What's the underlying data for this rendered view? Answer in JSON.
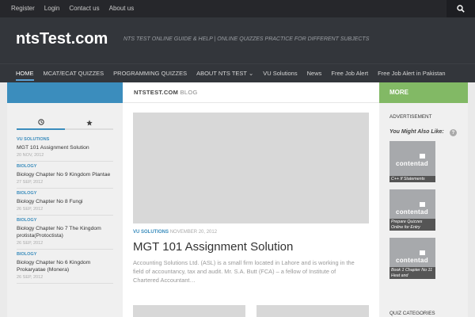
{
  "topbar": {
    "links": [
      "Register",
      "Login",
      "Contact us",
      "About us"
    ]
  },
  "header": {
    "site_title": "ntsTest.com",
    "tagline": "NTS TEST ONLINE GUIDE & HELP | ONLINE QUIZZES PRACTICE FOR DIFFERENT SUBJECTS"
  },
  "mainnav": {
    "items": [
      "HOME",
      "MCAT/ECAT QUIZZES",
      "PROGRAMMING QUIZZES",
      "ABOUT NTS TEST",
      "VU Solutions",
      "News",
      "Free Job Alert",
      "Free Job Alert in Pakistan"
    ],
    "dropdown_caret": "⌄"
  },
  "blog_head": {
    "site": "NTSTEST.COM",
    "label": "BLOG"
  },
  "more_label": "MORE",
  "sidebar_posts": [
    {
      "cat": "VU SOLUTIONS",
      "title": "MGT 101 Assignment Solution",
      "date": "20 NOV, 2012"
    },
    {
      "cat": "BIOLOGY",
      "title": "Biology Chapter No 9 Kingdom Plantae",
      "date": "27 SEP, 2012"
    },
    {
      "cat": "BIOLOGY",
      "title": "Biology Chapter No 8 Fungi",
      "date": "26 SEP, 2012"
    },
    {
      "cat": "BIOLOGY",
      "title": "Biology Chapter No 7 The Kingdom protista(Protoctista)",
      "date": "26 SEP, 2012"
    },
    {
      "cat": "BIOLOGY",
      "title": "Biology Chapter No 6 Kingdom Prokaryatae (Monera)",
      "date": "26 SEP, 2012"
    }
  ],
  "post": {
    "cat": "VU SOLUTIONS",
    "date": "NOVEMBER 20, 2012",
    "title": "MGT 101 Assignment Solution",
    "excerpt": "Accounting Solutions Ltd. (ASL) is a small firm located in Lahore and is working in the field of accountancy, tax and audit. Mr. S.A. Butt (FCA) – a fellow of Institute of Chartered Accountant…"
  },
  "right": {
    "advertisement": "ADVERTISEMENT",
    "you_might": "You Might Also Like:",
    "help": "?",
    "related": [
      {
        "brand": "contentad",
        "caption": "C++ If Statements"
      },
      {
        "brand": "contentad",
        "caption": "Prepare Quizzes Online for Entry"
      },
      {
        "brand": "contentad",
        "caption": "Book 1 Chapter No 11 Heat and"
      }
    ],
    "quiz_categories": "QUIZ CATEGORIES"
  },
  "colors": {
    "blue": "#3b8dbd",
    "green": "#82b965",
    "dark": "#33363b"
  }
}
